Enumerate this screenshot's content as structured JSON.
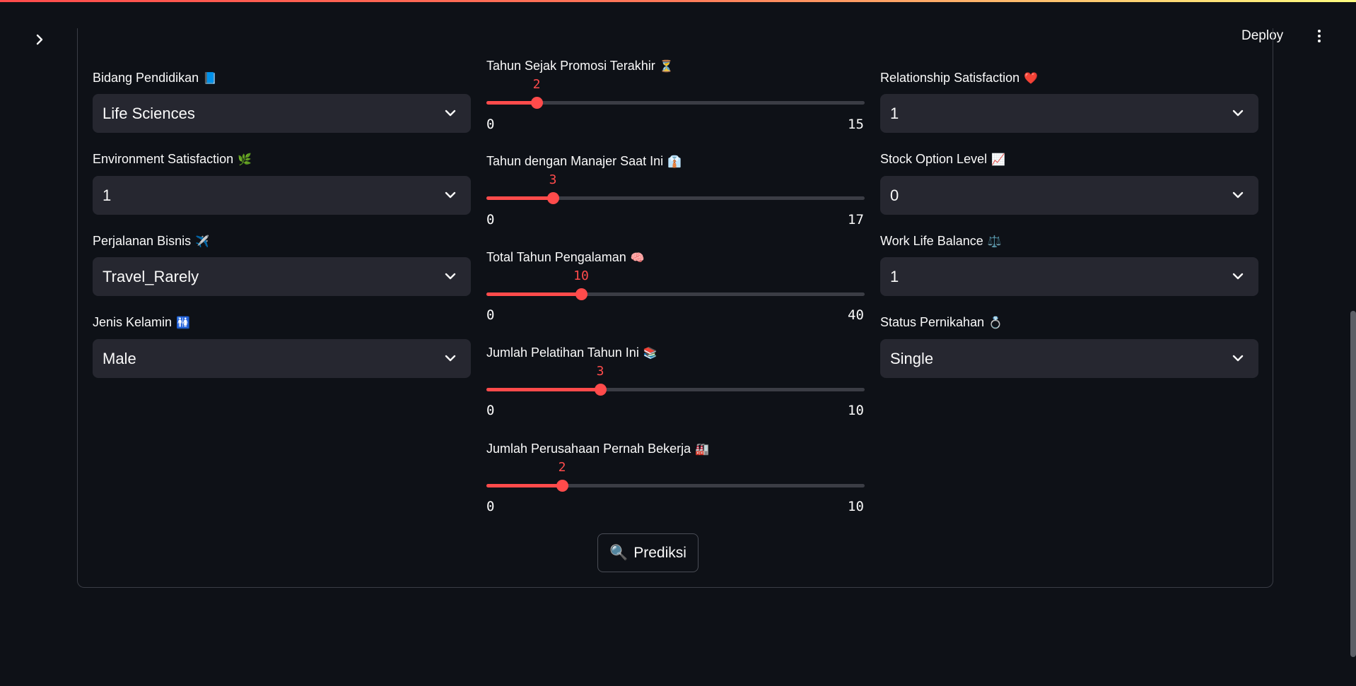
{
  "header": {
    "deploy_label": "Deploy"
  },
  "colors": {
    "accent": "#ff4b4b",
    "background": "#0e1117",
    "input_bg": "#262730"
  },
  "left_column": [
    {
      "label": "Bidang Pendidikan",
      "emoji": "📘",
      "value": "Life Sciences"
    },
    {
      "label": "Environment Satisfaction",
      "emoji": "🌿",
      "value": "1"
    },
    {
      "label": "Perjalanan Bisnis",
      "emoji": "✈️",
      "value": "Travel_Rarely"
    },
    {
      "label": "Jenis Kelamin",
      "emoji": "🚻",
      "value": "Male"
    }
  ],
  "sliders": [
    {
      "label": "Tahun Sejak Promosi Terakhir",
      "emoji": "⏳",
      "value": 2,
      "min": 0,
      "max": 15
    },
    {
      "label": "Tahun dengan Manajer Saat Ini",
      "emoji": "👔",
      "value": 3,
      "min": 0,
      "max": 17
    },
    {
      "label": "Total Tahun Pengalaman",
      "emoji": "🧠",
      "value": 10,
      "min": 0,
      "max": 40
    },
    {
      "label": "Jumlah Pelatihan Tahun Ini",
      "emoji": "📚",
      "value": 3,
      "min": 0,
      "max": 10
    },
    {
      "label": "Jumlah Perusahaan Pernah Bekerja",
      "emoji": "🏭",
      "value": 2,
      "min": 0,
      "max": 10
    }
  ],
  "right_column": [
    {
      "label": "Relationship Satisfaction",
      "emoji": "❤️",
      "value": "1"
    },
    {
      "label": "Stock Option Level",
      "emoji": "📈",
      "value": "0"
    },
    {
      "label": "Work Life Balance",
      "emoji": "⚖️",
      "value": "1"
    },
    {
      "label": "Status Pernikahan",
      "emoji": "💍",
      "value": "Single"
    }
  ],
  "predict_button": {
    "icon": "🔍",
    "label": "Prediksi"
  }
}
